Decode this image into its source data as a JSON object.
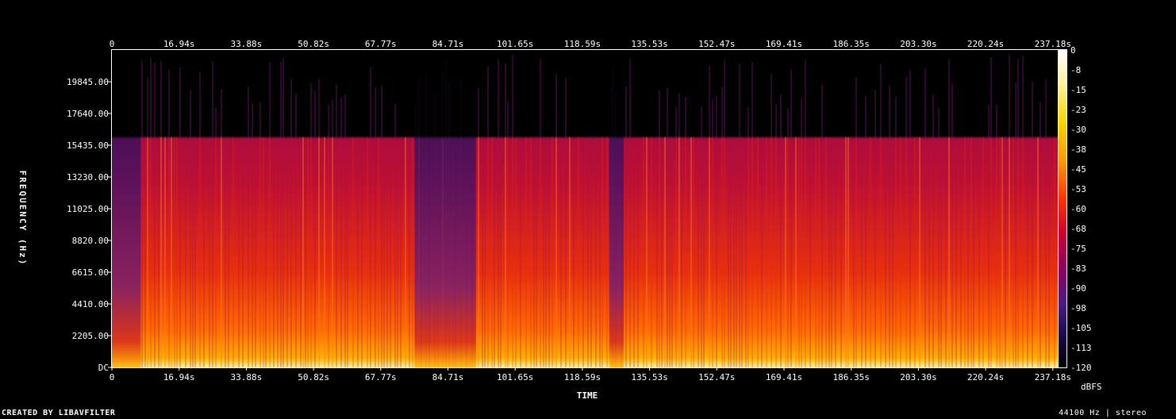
{
  "chart_data": {
    "type": "heatmap",
    "title": "",
    "xlabel": "TIME",
    "ylabel": "FREQUENCY (Hz)",
    "x_ticks": [
      "0",
      "16.94s",
      "33.88s",
      "50.82s",
      "67.77s",
      "84.71s",
      "101.65s",
      "118.59s",
      "135.53s",
      "152.47s",
      "169.41s",
      "186.35s",
      "203.30s",
      "220.24s",
      "237.18s"
    ],
    "y_ticks": [
      "DC",
      "2205.00",
      "4410.00",
      "6615.00",
      "8820.00",
      "11025.00",
      "13230.00",
      "15435.00",
      "17640.00",
      "19845.00"
    ],
    "colorbar_label": "dBFS",
    "colorbar_ticks": [
      "0",
      "-8",
      "-15",
      "-23",
      "-30",
      "-38",
      "-45",
      "-53",
      "-60",
      "-68",
      "-75",
      "-83",
      "-90",
      "-98",
      "-105",
      "-113",
      "-120"
    ],
    "colorscale": [
      "#ffffff",
      "#fff3a0",
      "#ffd700",
      "#ff9900",
      "#ff5500",
      "#ee2200",
      "#cc0033",
      "#880066",
      "#4a1a8a",
      "#1a0a50",
      "#000000"
    ],
    "xlim": [
      0,
      264
    ],
    "ylim": [
      0,
      22050
    ],
    "sample_rate_hz": 44100,
    "channels": "stereo",
    "quiet_intervals_s": [
      [
        0,
        8
      ],
      [
        84,
        101
      ],
      [
        138,
        142
      ]
    ],
    "high_frequency_cutoff_hz": 16000
  },
  "footer": {
    "left": "CREATED BY LIBAVFILTER",
    "right": "44100 Hz | stereo"
  }
}
